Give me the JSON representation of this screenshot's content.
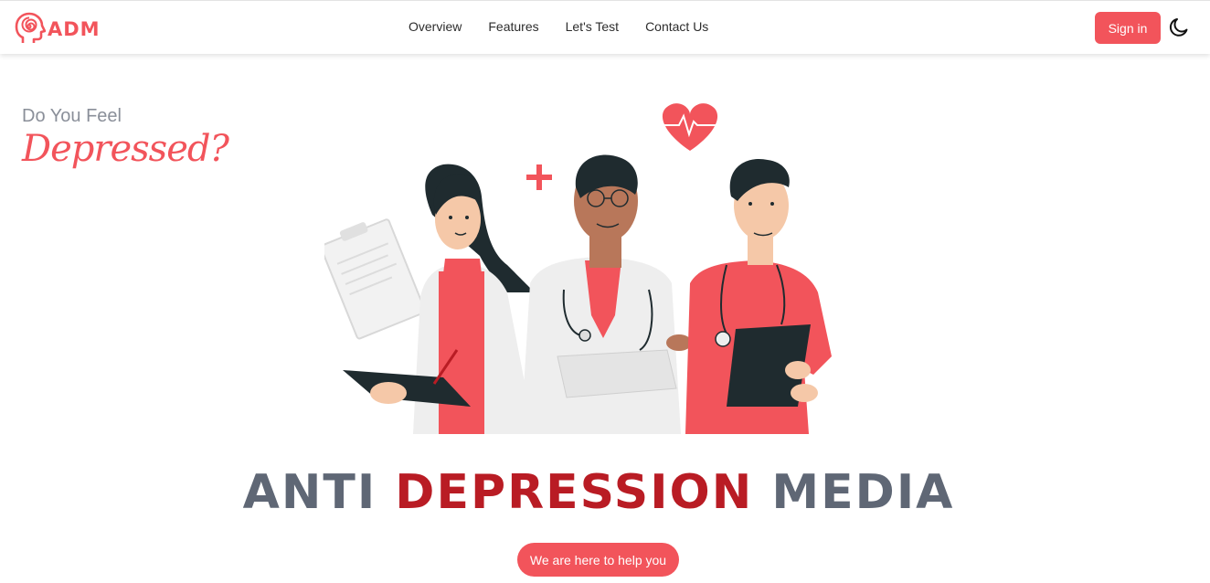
{
  "header": {
    "logo_text": "ADM",
    "nav": [
      "Overview",
      "Features",
      "Let's Test",
      "Contact Us"
    ],
    "signin_label": "Sign in",
    "theme_icon": "moon-icon"
  },
  "hero": {
    "question_line1": "Do You Feel",
    "question_line2": "Depressed?",
    "title_part1": "ANTI",
    "title_part2": "DEPRESSION",
    "title_part3": "MEDIA",
    "cta_label": "We are here to help you"
  },
  "colors": {
    "accent": "#f2545b",
    "title_red": "#b91c24",
    "title_grey": "#5f6775",
    "muted_text": "#8a8f99",
    "dark": "#1f2b2f"
  }
}
